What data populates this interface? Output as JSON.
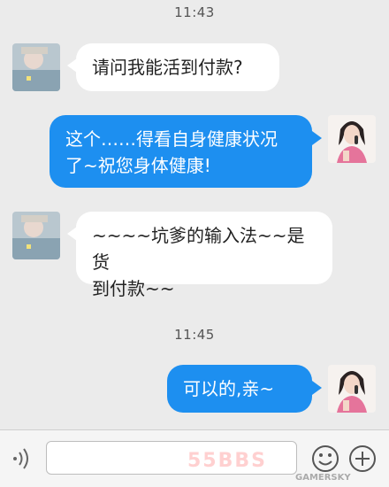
{
  "chat": {
    "messages": [
      {
        "timestamp": "11:43"
      },
      {
        "side": "in",
        "text": "请问我能活到付款?"
      },
      {
        "side": "out",
        "line1": "这个……得看自身健康状况",
        "line2": "了~祝您身体健康!"
      },
      {
        "side": "in",
        "line1": "~~~~坑爹的输入法~~是货",
        "line2": "到付款~~"
      },
      {
        "timestamp": "11:45"
      },
      {
        "side": "out",
        "text": "可以的,亲~"
      }
    ]
  },
  "input_bar": {
    "text_value": "",
    "icons": [
      "voice-icon",
      "emoji-icon",
      "plus-icon"
    ]
  },
  "watermark": {
    "text": "55BBS",
    "sub": "GAMERSKY"
  },
  "colors": {
    "background": "#ebebeb",
    "outgoing_bubble": "#1d8ff0",
    "incoming_bubble": "#ffffff"
  }
}
